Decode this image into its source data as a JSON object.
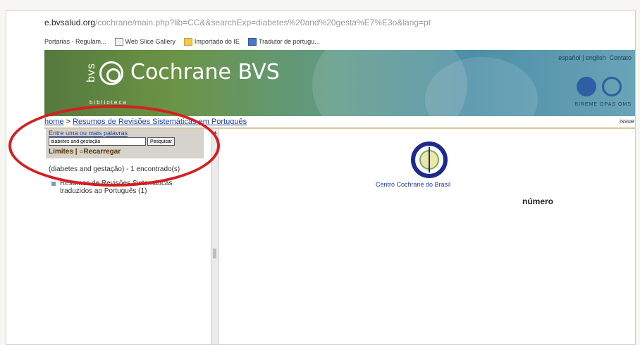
{
  "browser": {
    "url_domain": "e.bvsalud.org",
    "url_path": "/cochrane/main.php?lib=CC&&searchExp=diabetes%20and%20gesta%E7%E3o&lang=pt",
    "bookmarks": [
      "Portarias - Regulam...",
      "Web Slice Gallery",
      "Importado do IE",
      "Tradutor de portugu..."
    ]
  },
  "banner": {
    "brand": "Cochrane BVS",
    "logo_side": "bvs",
    "logo_sub": "biblioteca",
    "languages": "español | english",
    "contact": "Contato",
    "orgs": "BIREME  OPAS  OMS"
  },
  "breadcrumb": {
    "home": "home",
    "separator": " > ",
    "section": "Resumos de Revisões Sistemáticas em Português",
    "issue": "issue"
  },
  "sidebar": {
    "search_hint": "Entre uma ou mais palavras",
    "search_value": "diabetes and gestação",
    "search_button": "Pesquisar",
    "limits": "Limites",
    "separator": " | ",
    "reload": "Recarregar",
    "result_count": "(diabetes and gestação) - 1 encontrado(s)",
    "result_item": "Resumos de Revisões Sistemáticas traduzidos ao Português (1)"
  },
  "main": {
    "centro": "Centro Cochrane do Brasil",
    "numero": "número"
  },
  "colors": {
    "annotation_oval": "#d61f1f",
    "link": "#1c3e9a",
    "logo_blue": "#1d2a8c"
  }
}
